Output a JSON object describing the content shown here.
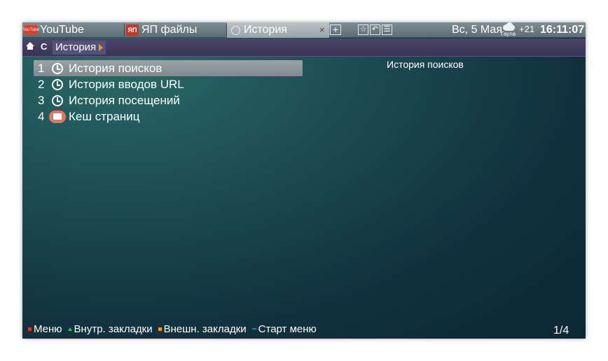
{
  "tabs": [
    {
      "label": "YouTube",
      "icon": "youtube-icon",
      "icon_text": "YouTube",
      "active": false
    },
    {
      "label": "ЯП файлы",
      "icon": "yap-icon",
      "icon_text": "ЯП",
      "active": false
    },
    {
      "label": "История",
      "icon": "clock-icon",
      "active": true
    }
  ],
  "tab_controls": {
    "close": "×",
    "new_tab": "+"
  },
  "toolbar": {
    "star": "☆",
    "back": "↶",
    "list": "☰"
  },
  "status": {
    "date": "Вс, 5 Мая",
    "weather_city": "Гаула",
    "temperature": "+21",
    "time": "16:11:07"
  },
  "navbar": {
    "reload": "C",
    "breadcrumb": "История"
  },
  "list": {
    "items": [
      {
        "num": "1",
        "label": "История поисков",
        "icon": "clock-icon",
        "selected": true
      },
      {
        "num": "2",
        "label": "История вводов URL",
        "icon": "clock-icon",
        "selected": false
      },
      {
        "num": "3",
        "label": "История посещений",
        "icon": "clock-icon",
        "selected": false
      },
      {
        "num": "4",
        "label": "Кеш страниц",
        "icon": "cache-icon",
        "selected": false
      }
    ]
  },
  "detail": {
    "title": "История поисков"
  },
  "footer": {
    "items": [
      {
        "label": "Меню",
        "color": "#e0302a",
        "marker": "square"
      },
      {
        "label": "Внутр. закладки",
        "color": "#2ecc40",
        "marker": "triangle"
      },
      {
        "label": "Внешн. закладки",
        "color": "#f39c12",
        "marker": "square"
      },
      {
        "label": "Старт меню",
        "color": "#2e6de0",
        "marker": "dash"
      }
    ],
    "page": "1/4"
  },
  "colors": {
    "background": "#1d4c52",
    "selected_row": "#8f989d",
    "navbar": "#433d62",
    "accent": "#f39c12"
  }
}
